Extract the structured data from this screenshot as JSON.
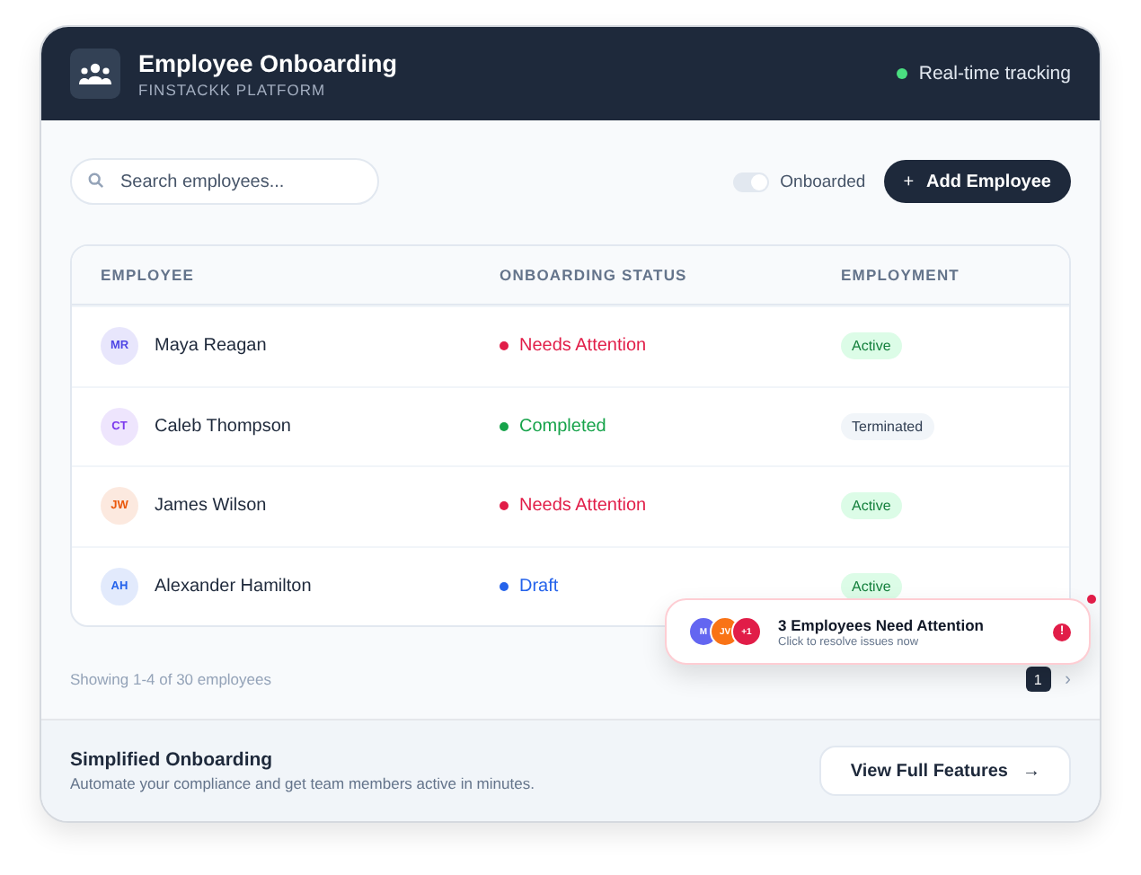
{
  "header": {
    "title": "Employee Onboarding",
    "subtitle": "FINSTACKK PLATFORM",
    "live": "Real-time tracking"
  },
  "toolbar": {
    "search": {
      "placeholder": "Search employees..."
    },
    "toggle": {
      "label": "Onboarded",
      "on": true
    },
    "add_button": "Add Employee",
    "add_icon": "+"
  },
  "table": {
    "columns": [
      "EMPLOYEE",
      "ONBOARDING STATUS",
      "EMPLOYMENT"
    ],
    "rows": [
      {
        "avatar": {
          "initials": "MR",
          "color": "#4f46e5"
        },
        "name": "Maya Reagan",
        "status": {
          "label": "Needs Attention",
          "color": "#e11d48"
        },
        "employment": {
          "label": "Active",
          "kind": "active"
        }
      },
      {
        "avatar": {
          "initials": "CT",
          "color": "#7c3aed"
        },
        "name": "Caleb Thompson",
        "status": {
          "label": "Completed",
          "color": "#16a34a"
        },
        "employment": {
          "label": "Terminated",
          "kind": "terminated"
        }
      },
      {
        "avatar": {
          "initials": "JW",
          "color": "#ea580c"
        },
        "name": "James Wilson",
        "status": {
          "label": "Needs Attention",
          "color": "#e11d48"
        },
        "employment": {
          "label": "Active",
          "kind": "active"
        }
      },
      {
        "avatar": {
          "initials": "AH",
          "color": "#2563eb"
        },
        "name": "Alexander Hamilton",
        "status": {
          "label": "Draft",
          "color": "#2563eb"
        },
        "employment": {
          "label": "Active",
          "kind": "active"
        }
      }
    ]
  },
  "footer": {
    "showing": "Showing 1-4 of 30 employees",
    "pages": [
      {
        "label": "1",
        "selected": true
      }
    ],
    "next": "›"
  },
  "toast": {
    "title": "3 Employees Need Attention",
    "subtitle": "Click to resolve issues now",
    "avatars": [
      {
        "label": "M",
        "color": "#6366f1"
      },
      {
        "label": "JV",
        "color": "#f97316"
      },
      {
        "label": "+1",
        "color": "#e11d48"
      }
    ],
    "alert": "!"
  },
  "banner": {
    "title": "Simplified Onboarding",
    "text": "Automate your compliance and get team members active in minutes.",
    "button": "View Full Features",
    "button_icon": "→"
  }
}
